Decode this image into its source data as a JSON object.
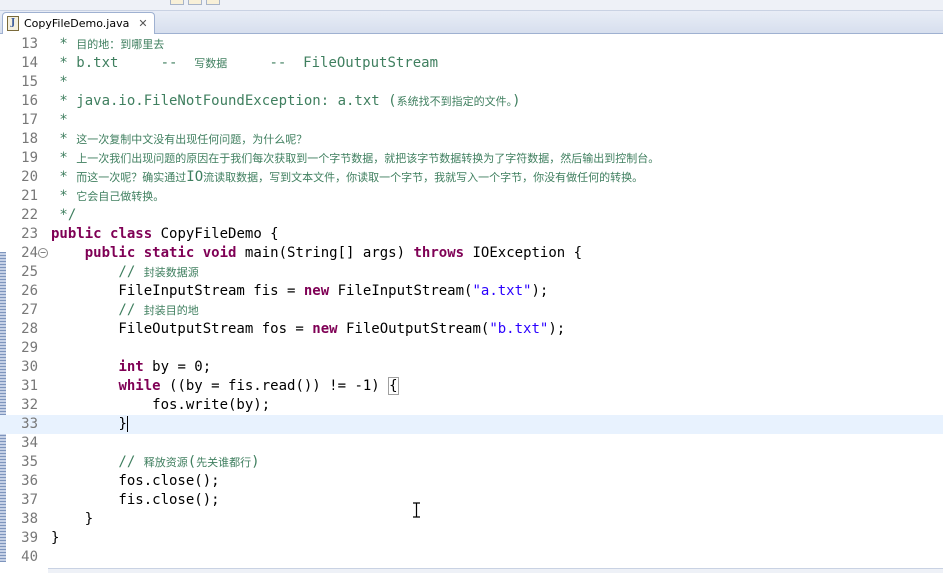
{
  "tab": {
    "title": "CopyFileDemo.java",
    "icon": "java-file-icon",
    "close_glyph": "✕"
  },
  "editor": {
    "current_line": 33,
    "lines": [
      {
        "num": "13",
        "segments": [
          {
            "t": " * 目的地：到哪里去",
            "c": "jdoc"
          }
        ]
      },
      {
        "num": "14",
        "segments": [
          {
            "t": " * b.txt     --  写数据     --  FileOutputStream",
            "c": "jdoc"
          }
        ]
      },
      {
        "num": "15",
        "segments": [
          {
            "t": " *",
            "c": "jdoc"
          }
        ]
      },
      {
        "num": "16",
        "segments": [
          {
            "t": " * java.io.FileNotFoundException: a.txt (系统找不到指定的文件。)",
            "c": "jdoc"
          }
        ]
      },
      {
        "num": "17",
        "segments": [
          {
            "t": " *",
            "c": "jdoc"
          }
        ]
      },
      {
        "num": "18",
        "segments": [
          {
            "t": " * 这一次复制中文没有出现任何问题，为什么呢？",
            "c": "jdoc"
          }
        ]
      },
      {
        "num": "19",
        "segments": [
          {
            "t": " * 上一次我们出现问题的原因在于我们每次获取到一个字节数据，就把该字节数据转换为了字符数据，然后输出到控制台。",
            "c": "jdoc"
          }
        ]
      },
      {
        "num": "20",
        "segments": [
          {
            "t": " * 而这一次呢？确实通过IO流读取数据，写到文本文件，你读取一个字节，我就写入一个字节，你没有做任何的转换。",
            "c": "jdoc"
          }
        ]
      },
      {
        "num": "21",
        "segments": [
          {
            "t": " * 它会自己做转换。",
            "c": "jdoc"
          }
        ]
      },
      {
        "num": "22",
        "segments": [
          {
            "t": " */",
            "c": "jdoc"
          }
        ]
      },
      {
        "num": "23",
        "segments": [
          {
            "t": "public",
            "c": "kw"
          },
          {
            "t": " ",
            "c": "plain"
          },
          {
            "t": "class",
            "c": "kw"
          },
          {
            "t": " CopyFileDemo {",
            "c": "plain"
          }
        ]
      },
      {
        "num": "24",
        "fold": "⊖",
        "segments": [
          {
            "t": "    ",
            "c": "plain"
          },
          {
            "t": "public",
            "c": "kw"
          },
          {
            "t": " ",
            "c": "plain"
          },
          {
            "t": "static",
            "c": "kw"
          },
          {
            "t": " ",
            "c": "plain"
          },
          {
            "t": "void",
            "c": "kw"
          },
          {
            "t": " main(String[] args) ",
            "c": "plain"
          },
          {
            "t": "throws",
            "c": "kw"
          },
          {
            "t": " IOException {",
            "c": "plain"
          }
        ]
      },
      {
        "num": "25",
        "segments": [
          {
            "t": "        // 封装数据源",
            "c": "comment"
          }
        ]
      },
      {
        "num": "26",
        "segments": [
          {
            "t": "        FileInputStream fis = ",
            "c": "plain"
          },
          {
            "t": "new",
            "c": "kw"
          },
          {
            "t": " FileInputStream(",
            "c": "plain"
          },
          {
            "t": "\"a.txt\"",
            "c": "str"
          },
          {
            "t": ");",
            "c": "plain"
          }
        ]
      },
      {
        "num": "27",
        "segments": [
          {
            "t": "        // 封装目的地",
            "c": "comment"
          }
        ]
      },
      {
        "num": "28",
        "segments": [
          {
            "t": "        FileOutputStream fos = ",
            "c": "plain"
          },
          {
            "t": "new",
            "c": "kw"
          },
          {
            "t": " FileOutputStream(",
            "c": "plain"
          },
          {
            "t": "\"b.txt\"",
            "c": "str"
          },
          {
            "t": ");",
            "c": "plain"
          }
        ]
      },
      {
        "num": "29",
        "segments": []
      },
      {
        "num": "30",
        "segments": [
          {
            "t": "        ",
            "c": "plain"
          },
          {
            "t": "int",
            "c": "kw"
          },
          {
            "t": " by = 0;",
            "c": "plain"
          }
        ]
      },
      {
        "num": "31",
        "segments": [
          {
            "t": "        ",
            "c": "plain"
          },
          {
            "t": "while",
            "c": "kw"
          },
          {
            "t": " ((by = fis.read()) != -1) ",
            "c": "plain"
          },
          {
            "t": "{",
            "c": "bracket"
          }
        ]
      },
      {
        "num": "32",
        "segments": [
          {
            "t": "            fos.write(by);",
            "c": "plain"
          }
        ]
      },
      {
        "num": "33",
        "segments": [
          {
            "t": "        ",
            "c": "plain"
          },
          {
            "t": "}",
            "c": "bracket"
          }
        ],
        "caret": true
      },
      {
        "num": "34",
        "segments": []
      },
      {
        "num": "35",
        "segments": [
          {
            "t": "        // 释放资源(先关谁都行)",
            "c": "comment"
          }
        ]
      },
      {
        "num": "36",
        "segments": [
          {
            "t": "        fos.close();",
            "c": "plain"
          }
        ]
      },
      {
        "num": "37",
        "segments": [
          {
            "t": "        fis.close();",
            "c": "plain"
          }
        ]
      },
      {
        "num": "38",
        "segments": [
          {
            "t": "    }",
            "c": "plain"
          }
        ]
      },
      {
        "num": "39",
        "segments": [
          {
            "t": "}",
            "c": "plain"
          }
        ]
      },
      {
        "num": "40",
        "segments": []
      }
    ]
  },
  "colors": {
    "keyword": "#7f0055",
    "string": "#2a00ff",
    "comment": "#3f7f5f",
    "line_number": "#787878",
    "current_line_bg": "#e8f2fe"
  }
}
